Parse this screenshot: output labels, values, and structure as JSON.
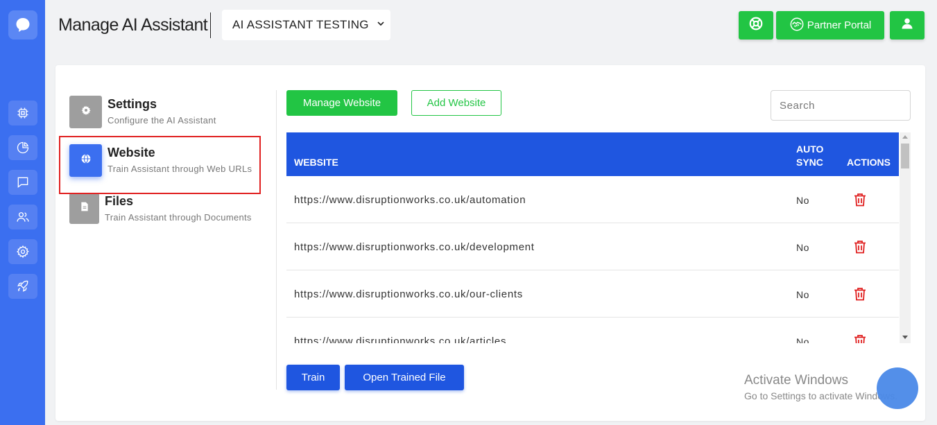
{
  "header": {
    "title": "Manage AI Assistant",
    "assistant_name": "AI ASSISTANT TESTING",
    "partner_portal_label": "Partner Portal"
  },
  "sidebar": {
    "icons": [
      "chat-bubble-logo",
      "chip-icon",
      "pie-chart-icon",
      "message-icon",
      "users-icon",
      "gear-icon",
      "rocket-icon"
    ]
  },
  "settings_nav": {
    "items": [
      {
        "title": "Settings",
        "subtitle": "Configure the AI Assistant",
        "icon": "gear-icon"
      },
      {
        "title": "Website",
        "subtitle": "Train Assistant through Web URLs",
        "icon": "globe-icon",
        "active": true
      },
      {
        "title": "Files",
        "subtitle": "Train Assistant through Documents",
        "icon": "document-icon"
      }
    ]
  },
  "toolbar": {
    "manage_website_label": "Manage Website",
    "add_website_label": "Add Website",
    "search_placeholder": "Search"
  },
  "table": {
    "headers": {
      "website": "WEBSITE",
      "auto_sync_line1": "AUTO",
      "auto_sync_line2": "SYNC",
      "actions": "ACTIONS"
    },
    "rows": [
      {
        "url": "https://www.disruptionworks.co.uk/automation",
        "auto_sync": "No"
      },
      {
        "url": "https://www.disruptionworks.co.uk/development",
        "auto_sync": "No"
      },
      {
        "url": "https://www.disruptionworks.co.uk/our-clients",
        "auto_sync": "No"
      },
      {
        "url": "https://www.disruptionworks.co.uk/articles",
        "auto_sync": "No"
      }
    ]
  },
  "footer": {
    "train_label": "Train",
    "open_trained_file_label": "Open Trained File"
  },
  "watermark": {
    "title": "Activate Windows",
    "subtitle": "Go to Settings to activate Windows."
  },
  "colors": {
    "primary_blue": "#1f56e0",
    "rail_blue": "#3b6ff0",
    "green": "#22c544",
    "danger": "#e02020"
  }
}
